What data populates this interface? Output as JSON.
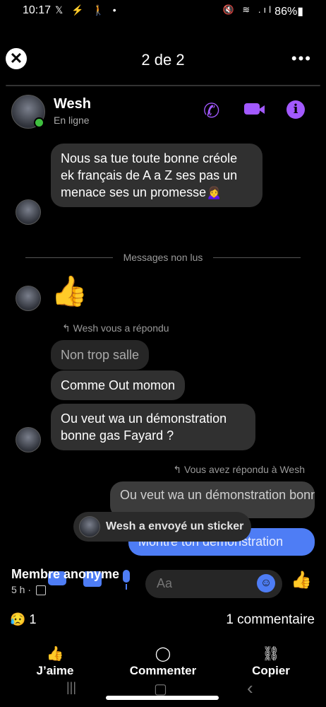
{
  "status_bar": {
    "time": "10:17",
    "left_icons": "𝕏 ⚡ 🚶 •",
    "right_icons": "🔇 ≋ .ıl",
    "battery": "86%▮"
  },
  "viewer": {
    "counter": "2 de 2",
    "close_symbol": "✕",
    "more_symbol": "•••"
  },
  "contact": {
    "name": "Wesh",
    "status": "En ligne",
    "call_icon": "✆",
    "video_icon": "▶",
    "info_icon": "ⓘ"
  },
  "messages": {
    "first": "Nous sa tue toute bonne créole ek français de A a Z ses pas un menace ses un promesse🙍‍♀️",
    "divider": "Messages non lus",
    "thumb": "👍",
    "reply_note_in": "↰ Wesh vous a répondu",
    "quoted": "Non trop salle",
    "msg2": "Comme Out momon",
    "msg3": "Ou veut wa un démonstration bonne gas Fayard ?",
    "reply_note_out": "↰ Vous avez répondu à Wesh",
    "quoted_out": "Ou veut wa un démonstration bonne gas Fayard ?",
    "outgoing": "Montre ton démonstration"
  },
  "toast": {
    "text": "Wesh a envoyé un sticker"
  },
  "composer": {
    "placeholder": "Aa",
    "emoji": "☺",
    "like": "👍"
  },
  "post": {
    "member": "Membre anonyme",
    "time": "5 h ·",
    "reaction_emoji": "😥",
    "reaction_count": "1",
    "comments": "1 commentaire"
  },
  "actions": [
    {
      "icon": "👍",
      "label": "J’aime"
    },
    {
      "icon": "◯",
      "label": "Commenter"
    },
    {
      "icon": "⛓",
      "label": "Copier"
    }
  ],
  "navbar": {
    "recent": "|||",
    "home": "▢",
    "back": "‹"
  },
  "colors": {
    "accent": "#a259ff",
    "messenger_blue": "#4e7df5",
    "bubble": "#303030"
  }
}
